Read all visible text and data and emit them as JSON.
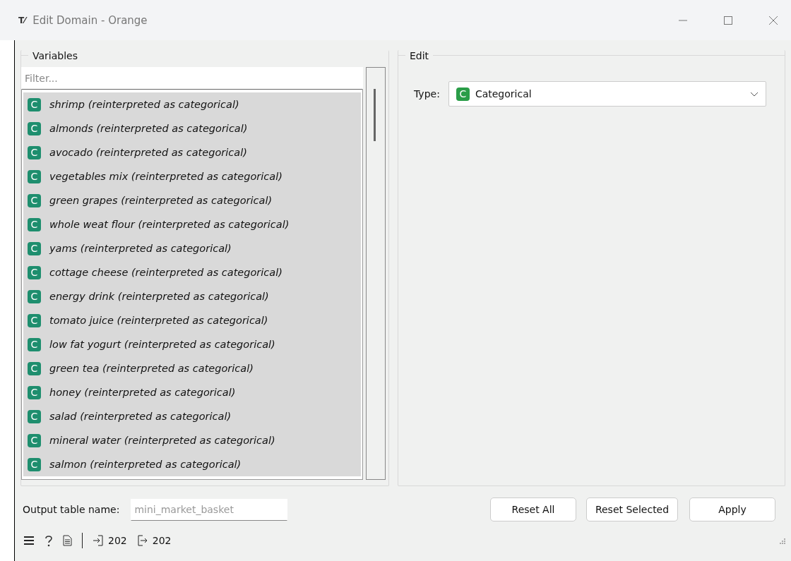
{
  "window": {
    "title": "Edit Domain - Orange",
    "app_icon": "T⁄"
  },
  "variables": {
    "title": "Variables",
    "filter": {
      "placeholder": "Filter..."
    },
    "items": [
      {
        "badge": "C",
        "label": "shrimp (reinterpreted as categorical)",
        "selected": true
      },
      {
        "badge": "C",
        "label": "almonds (reinterpreted as categorical)",
        "selected": true
      },
      {
        "badge": "C",
        "label": "avocado (reinterpreted as categorical)",
        "selected": true
      },
      {
        "badge": "C",
        "label": "vegetables mix (reinterpreted as categorical)",
        "selected": true
      },
      {
        "badge": "C",
        "label": "green grapes (reinterpreted as categorical)",
        "selected": true
      },
      {
        "badge": "C",
        "label": "whole weat flour (reinterpreted as categorical)",
        "selected": true
      },
      {
        "badge": "C",
        "label": "yams (reinterpreted as categorical)",
        "selected": true
      },
      {
        "badge": "C",
        "label": "cottage cheese (reinterpreted as categorical)",
        "selected": true
      },
      {
        "badge": "C",
        "label": "energy drink (reinterpreted as categorical)",
        "selected": true
      },
      {
        "badge": "C",
        "label": "tomato juice (reinterpreted as categorical)",
        "selected": true
      },
      {
        "badge": "C",
        "label": "low fat yogurt (reinterpreted as categorical)",
        "selected": true
      },
      {
        "badge": "C",
        "label": "green tea (reinterpreted as categorical)",
        "selected": true
      },
      {
        "badge": "C",
        "label": "honey (reinterpreted as categorical)",
        "selected": true
      },
      {
        "badge": "C",
        "label": "salad (reinterpreted as categorical)",
        "selected": true
      },
      {
        "badge": "C",
        "label": "mineral water (reinterpreted as categorical)",
        "selected": true
      },
      {
        "badge": "C",
        "label": "salmon (reinterpreted as categorical)",
        "selected": true
      }
    ]
  },
  "edit": {
    "title": "Edit",
    "type_label": "Type:",
    "type_badge": "C",
    "type_value": "Categorical"
  },
  "output": {
    "label": "Output table name:",
    "placeholder": "mini_market_basket"
  },
  "buttons": [
    "Reset All",
    "Reset Selected",
    "Apply"
  ],
  "status_bar": {
    "input_count": "202",
    "output_count": "202"
  }
}
